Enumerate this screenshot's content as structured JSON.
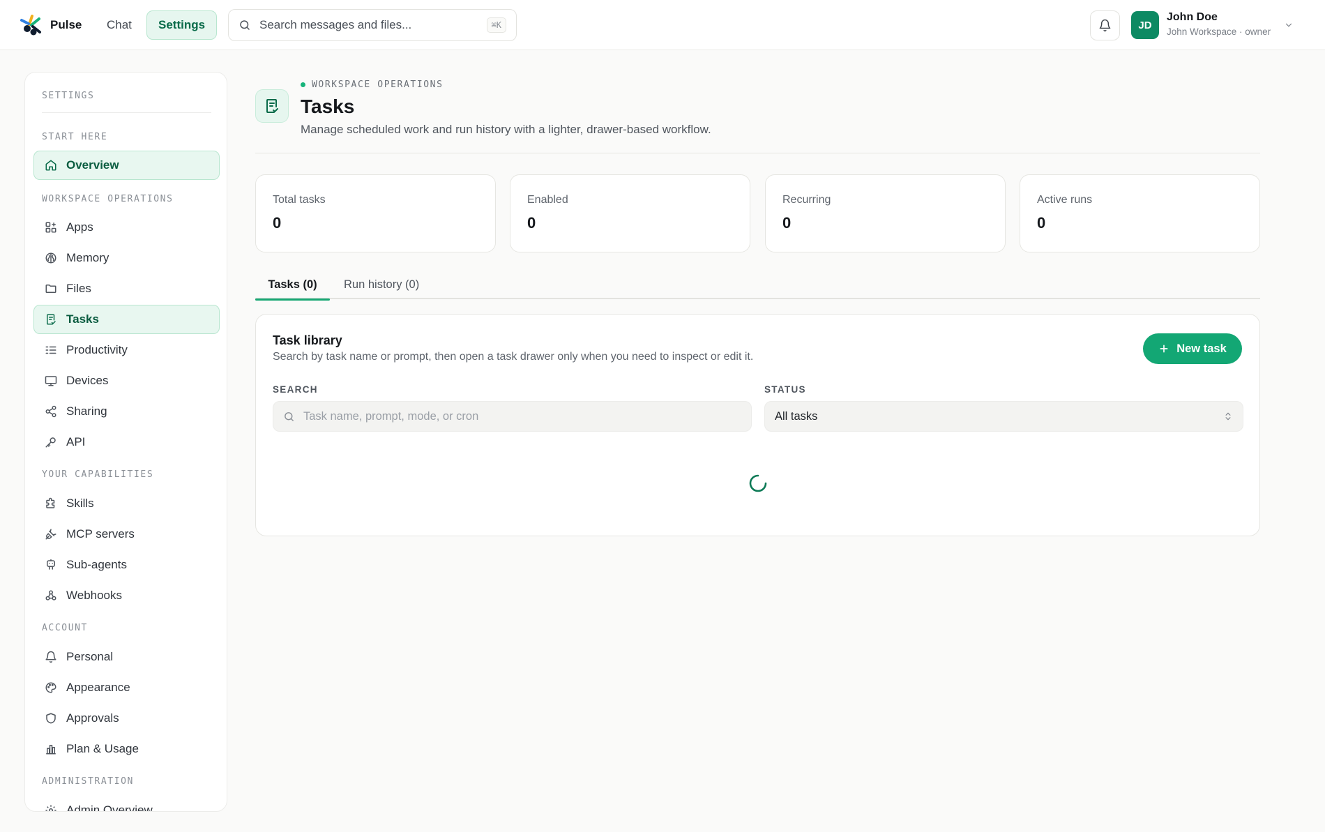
{
  "topbar": {
    "brand": "Pulse",
    "nav": [
      {
        "label": "Chat",
        "active": false
      },
      {
        "label": "Settings",
        "active": true
      }
    ],
    "search": {
      "placeholder": "Search messages and files...",
      "shortcut": "⌘K"
    },
    "user": {
      "initials": "JD",
      "name": "John Doe",
      "subtitle": "John Workspace · owner"
    }
  },
  "sidebar": {
    "title": "SETTINGS",
    "sections": [
      {
        "heading": "START HERE",
        "items": [
          {
            "label": "Overview",
            "icon": "home-icon"
          }
        ]
      },
      {
        "heading": "WORKSPACE OPERATIONS",
        "items": [
          {
            "label": "Apps",
            "icon": "apps-icon"
          },
          {
            "label": "Memory",
            "icon": "brain-icon"
          },
          {
            "label": "Files",
            "icon": "folder-icon"
          },
          {
            "label": "Tasks",
            "icon": "task-icon"
          },
          {
            "label": "Productivity",
            "icon": "list-checks-icon"
          },
          {
            "label": "Devices",
            "icon": "monitor-icon"
          },
          {
            "label": "Sharing",
            "icon": "share-icon"
          },
          {
            "label": "API",
            "icon": "key-icon"
          }
        ]
      },
      {
        "heading": "YOUR CAPABILITIES",
        "items": [
          {
            "label": "Skills",
            "icon": "puzzle-icon"
          },
          {
            "label": "MCP servers",
            "icon": "plug-icon"
          },
          {
            "label": "Sub-agents",
            "icon": "bot-icon"
          },
          {
            "label": "Webhooks",
            "icon": "webhook-icon"
          }
        ]
      },
      {
        "heading": "ACCOUNT",
        "items": [
          {
            "label": "Personal",
            "icon": "bell-icon"
          },
          {
            "label": "Appearance",
            "icon": "palette-icon"
          },
          {
            "label": "Approvals",
            "icon": "shield-icon"
          },
          {
            "label": "Plan & Usage",
            "icon": "chart-icon"
          }
        ]
      },
      {
        "heading": "ADMINISTRATION",
        "items": [
          {
            "label": "Admin Overview",
            "icon": "gear-icon"
          }
        ]
      }
    ]
  },
  "header": {
    "eyebrow": "WORKSPACE OPERATIONS",
    "title": "Tasks",
    "subtitle": "Manage scheduled work and run history with a lighter, drawer-based workflow."
  },
  "stats": [
    {
      "label": "Total tasks",
      "value": "0"
    },
    {
      "label": "Enabled",
      "value": "0"
    },
    {
      "label": "Recurring",
      "value": "0"
    },
    {
      "label": "Active runs",
      "value": "0"
    }
  ],
  "tabs": [
    {
      "label": "Tasks (0)",
      "active": true
    },
    {
      "label": "Run history (0)",
      "active": false
    }
  ],
  "library": {
    "title": "Task library",
    "subtitle": "Search by task name or prompt, then open a task drawer only when you need to inspect or edit it.",
    "new_task_label": "New task",
    "search_label": "SEARCH",
    "search_placeholder": "Task name, prompt, mode, or cron",
    "status_label": "STATUS",
    "status_value": "All tasks"
  },
  "colors": {
    "accent": "#13a774",
    "accent_light": "#e6f6ef",
    "avatar": "#0d8a63"
  }
}
